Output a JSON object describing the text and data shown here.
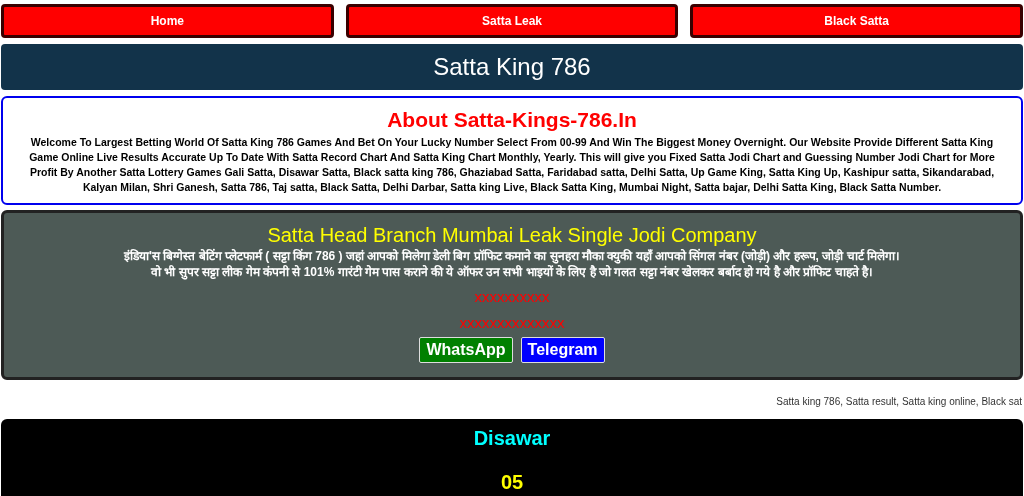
{
  "nav": [
    {
      "label": "Home"
    },
    {
      "label": "Satta Leak"
    },
    {
      "label": "Black Satta"
    }
  ],
  "site_title": "Satta King 786",
  "about": {
    "title": "About Satta-Kings-786.In",
    "text": "Welcome To Largest Betting World Of Satta King 786 Games And Bet On Your Lucky Number Select From 00-99 And Win The Biggest Money Overnight. Our Website Provide Different Satta King Game Online Live Results Accurate Up To Date With Satta Record Chart And Satta King Chart Monthly, Yearly. This will give you Fixed Satta Jodi Chart and Guessing Number Jodi Chart for More Profit By Another Satta Lottery Games Gali Satta, Disawar Satta, Black satta king 786, Ghaziabad Satta, Faridabad satta, Delhi Satta, Up Game King, Satta King Up, Kashipur satta, Sikandarabad, Kalyan Milan, Shri Ganesh, Satta 786, Taj satta, Black Satta, Delhi Darbar, Satta king Live, Black Satta King, Mumbai Night, Satta bajar, Delhi Satta King, Black Satta Number."
  },
  "company": {
    "title": "Satta Head Branch Mumbai Leak Single Jodi Company",
    "lines": [
      "इंडिया'स बिग्गेस्त बेटिंग प्लेटफार्म ( सट्टा किंग 786 ) जहां आपको मिलेगा डेली बिग प्रॉफिट कमाने का सुनहरा मौका क्युकी यहाँ आपको सिंगल नंबर (जोड़ी) और हरूप, जोड़ी चार्ट मिलेगा।",
      "वो भी सुपर सट्टा लीक गेम कंपनी से 101% गारंटी गेम पास कराने की ये ऑफर उन सभी भाइयों के लिए है जो गलत सट्टा नंबर खेलकर बर्बाद हो गये है और प्रॉफिट चाहते है।"
    ],
    "masked": [
      "xxxxxxxxxx",
      "xxxxxxxxxxxxxx"
    ],
    "buttons": [
      {
        "label": "WhatsApp",
        "kind": "whatsapp"
      },
      {
        "label": "Telegram",
        "kind": "telegram"
      }
    ]
  },
  "marquee": "Satta king 786, Satta result, Satta king online, Black sat",
  "result": {
    "game": "Disawar",
    "number": "05"
  }
}
